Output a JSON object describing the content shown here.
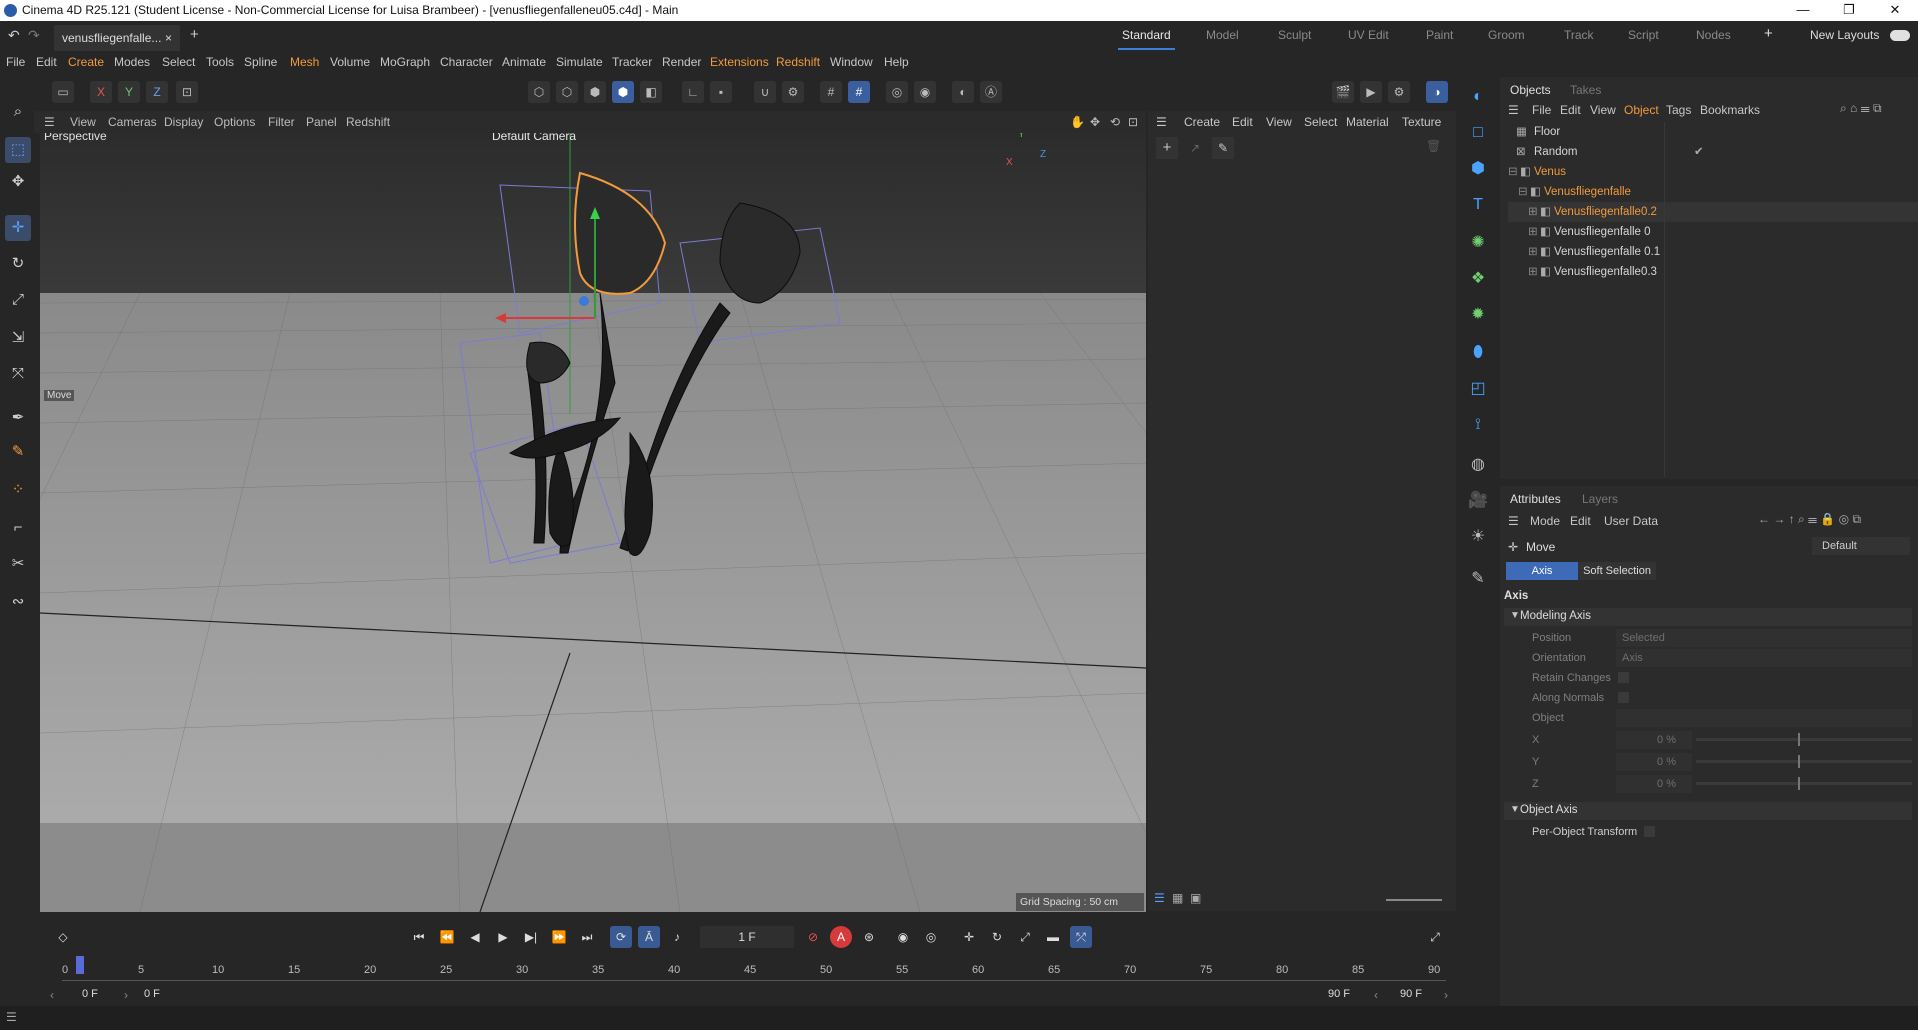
{
  "title": "Cinema 4D R25.121 (Student License - Non-Commercial License for Luisa Brambeer) - [venusfliegenfalleneu05.c4d] - Main",
  "window_controls": {
    "minimize": "—",
    "maximize": "❐",
    "close": "✕"
  },
  "doc_tab": {
    "label": "venusfliegenfalle...",
    "close": "×",
    "add": "+"
  },
  "layouts": [
    "Standard",
    "Model",
    "Sculpt",
    "UV Edit",
    "Paint",
    "Groom",
    "Track",
    "Script",
    "Nodes"
  ],
  "layouts_add": "+",
  "new_layouts": "New Layouts",
  "menu": [
    "File",
    "Edit",
    "Create",
    "Modes",
    "Select",
    "Tools",
    "Spline",
    "Mesh",
    "Volume",
    "MoGraph",
    "Character",
    "Animate",
    "Simulate",
    "Tracker",
    "Render",
    "Extensions",
    "Redshift",
    "Window",
    "Help"
  ],
  "toolbar": {
    "x": "X",
    "y": "Y",
    "z": "Z"
  },
  "viewport": {
    "menu": [
      "View",
      "Cameras",
      "Display",
      "Options",
      "Filter",
      "Panel",
      "Redshift"
    ],
    "label": "Perspective",
    "camera": "Default Camera",
    "move_hud": "Move",
    "grid_spacing": "Grid Spacing : 50 cm",
    "axis_y": "Y",
    "axis_x": "X",
    "axis_z": "Z"
  },
  "material_panel": {
    "menu": [
      "Create",
      "Edit",
      "View",
      "Select",
      "Material",
      "Texture"
    ]
  },
  "objects": {
    "tabs": [
      "Objects",
      "Takes"
    ],
    "menu": [
      "File",
      "Edit",
      "View",
      "Object",
      "Tags",
      "Bookmarks"
    ],
    "rows": [
      {
        "name": "Floor",
        "state": "normal"
      },
      {
        "name": "Random",
        "state": "normal"
      },
      {
        "name": "Venus",
        "state": "orange"
      },
      {
        "name": "Venusfliegenfalle",
        "state": "orange"
      },
      {
        "name": "Venusfliegenfalle0.2",
        "state": "orange"
      },
      {
        "name": "Venusfliegenfalle 0",
        "state": "normal"
      },
      {
        "name": "Venusfliegenfalle 0.1",
        "state": "normal"
      },
      {
        "name": "Venusfliegenfalle0.3",
        "state": "normal"
      }
    ]
  },
  "attributes": {
    "tabs": [
      "Attributes",
      "Layers"
    ],
    "menu": [
      "Mode",
      "Edit",
      "User Data"
    ],
    "tool": "Move",
    "preset": "Default",
    "subtabs": [
      "Axis",
      "Soft Selection"
    ],
    "section": "Axis",
    "modeling_axis": "Modeling Axis",
    "fields": [
      {
        "label": "Position",
        "value": "Selected"
      },
      {
        "label": "Orientation",
        "value": "Axis"
      },
      {
        "label": "Retain Changes",
        "value": ""
      },
      {
        "label": "Along Normals",
        "value": ""
      },
      {
        "label": "Object",
        "value": ""
      }
    ],
    "xyz": [
      {
        "label": "X",
        "value": "0 %"
      },
      {
        "label": "Y",
        "value": "0 %"
      },
      {
        "label": "Z",
        "value": "0 %"
      }
    ],
    "object_axis": "Object Axis",
    "per_object": "Per-Object Transform"
  },
  "timeline": {
    "frame": "1 F",
    "ticks": [
      "0",
      "5",
      "10",
      "15",
      "20",
      "25",
      "30",
      "35",
      "40",
      "45",
      "50",
      "55",
      "60",
      "65",
      "70",
      "75",
      "80",
      "85",
      "90"
    ],
    "start": "0 F",
    "range_start": "0 F",
    "range_end": "90 F",
    "end": "90 F"
  },
  "colors": {
    "accent": "#3d7fd8",
    "orange": "#f29a3c"
  }
}
